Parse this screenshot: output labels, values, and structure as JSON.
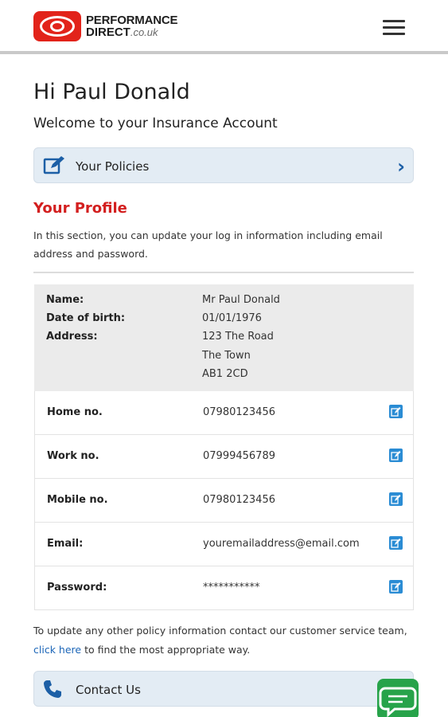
{
  "header": {
    "brand_line1": "PERFORMANCE",
    "brand_line2": "DIRECT",
    "brand_domain": ".co.uk",
    "brand_color": "#e2231a"
  },
  "greeting": "Hi Paul Donald",
  "welcome": "Welcome to your Insurance Account",
  "policies": {
    "label": "Your Policies",
    "icon": "edit-icon"
  },
  "profile": {
    "title": "Your Profile",
    "intro": "In this section, you can update your log in information including email address and password.",
    "name_label": "Name:",
    "name_value": "Mr Paul Donald",
    "dob_label": "Date of birth:",
    "dob_value": "01/01/1976",
    "address_label": "Address:",
    "address_lines": [
      "123 The Road",
      "The Town",
      "AB1 2CD"
    ],
    "rows": [
      {
        "label": "Home no.",
        "value": "07980123456"
      },
      {
        "label": "Work no.",
        "value": "07999456789"
      },
      {
        "label": "Mobile no.",
        "value": "07980123456"
      },
      {
        "label": "Email:",
        "value": "youremailaddress@email.com"
      },
      {
        "label": "Password:",
        "value": "***********"
      }
    ]
  },
  "footer": {
    "text_before": "To update any other policy information contact our customer service team,",
    "link": "click here",
    "text_after": "to find the most appropriate way."
  },
  "contact": {
    "label": "Contact Us",
    "icon": "phone-icon"
  },
  "colors": {
    "accent_red": "#d31f1f",
    "link_blue": "#1c66b8",
    "chat_green": "#27a34a"
  }
}
